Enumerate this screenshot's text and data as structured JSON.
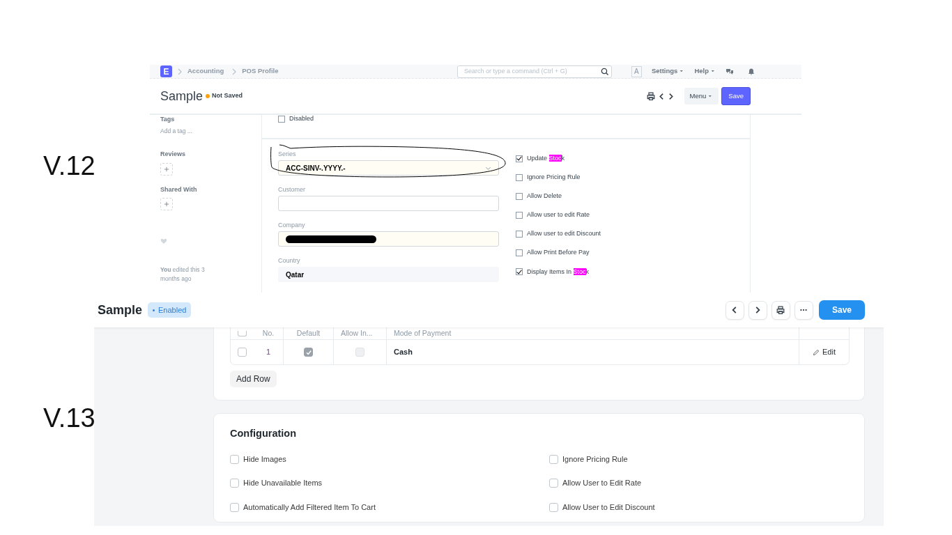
{
  "v12": {
    "label": "V.12",
    "logo": "E",
    "breadcrumbs": [
      "Accounting",
      "POS Profile"
    ],
    "search": {
      "placeholder": "Search or type a command (Ctrl + G)"
    },
    "avatar": "A",
    "nav_menus": [
      "Settings",
      "Help"
    ],
    "title": "Sample",
    "status": "Not Saved",
    "menu_button": "Menu",
    "save_button": "Save",
    "sidebar": {
      "tags_label": "Tags",
      "add_tag": "Add a tag ...",
      "reviews_label": "Reviews",
      "shared_label": "Shared With",
      "edit_note": "**You** edited this 3 months ago"
    },
    "disabled_checkbox": {
      "label": "Disabled",
      "checked": false
    },
    "fields": [
      {
        "label": "Series",
        "kind": "select",
        "value": "ACC-SINV-.YYYY.-",
        "circled": true
      },
      {
        "label": "Customer",
        "kind": "input",
        "circled": false
      },
      {
        "label": "Company",
        "kind": "input",
        "redacted": true,
        "circled": false
      },
      {
        "label": "Country",
        "kind": "readonly",
        "value": "Qatar",
        "circled": false
      }
    ],
    "options": [
      {
        "checked": true,
        "parts": [
          {
            "text": "Update ",
            "highlighted": false
          },
          {
            "text": "Stoc",
            "highlighted": true
          },
          {
            "text": "k",
            "highlighted": false
          }
        ]
      },
      {
        "checked": false,
        "parts": [
          {
            "text": "Ignore Pricing Rule",
            "highlighted": false
          }
        ]
      },
      {
        "checked": false,
        "parts": [
          {
            "text": "Allow Delete",
            "highlighted": false
          }
        ]
      },
      {
        "checked": false,
        "parts": [
          {
            "text": "Allow user to edit Rate",
            "highlighted": false
          }
        ]
      },
      {
        "checked": false,
        "parts": [
          {
            "text": "Allow user to edit Discount",
            "highlighted": false
          }
        ]
      },
      {
        "checked": false,
        "parts": [
          {
            "text": "Allow Print Before Pay",
            "highlighted": false
          }
        ]
      },
      {
        "checked": true,
        "parts": [
          {
            "text": "Display Items In ",
            "highlighted": false
          },
          {
            "text": "Stoc",
            "highlighted": true
          },
          {
            "text": "k",
            "highlighted": false
          }
        ]
      }
    ]
  },
  "v13": {
    "label": "V.13",
    "title": "Sample",
    "status": "Enabled",
    "save_button": "Save",
    "payments_table": {
      "header_checked": false,
      "columns": [
        "No.",
        "Default",
        "Allow In...",
        "Mode of Payment"
      ],
      "rows": [
        {
          "selected": false,
          "no": "1",
          "default_checked": true,
          "allow_in_checked": false,
          "mode": "Cash",
          "edit": "Edit"
        }
      ]
    },
    "add_row": "Add Row",
    "configuration": {
      "title": "Configuration",
      "options": [
        {
          "label": "Hide Images",
          "checked": false
        },
        {
          "label": "Ignore Pricing Rule",
          "checked": false
        },
        {
          "label": "Hide Unavailable Items",
          "checked": false
        },
        {
          "label": "Allow User to Edit Rate",
          "checked": false
        },
        {
          "label": "Automatically Add Filtered Item To Cart",
          "checked": false
        },
        {
          "label": "Allow User to Edit Discount",
          "checked": false
        }
      ]
    }
  }
}
